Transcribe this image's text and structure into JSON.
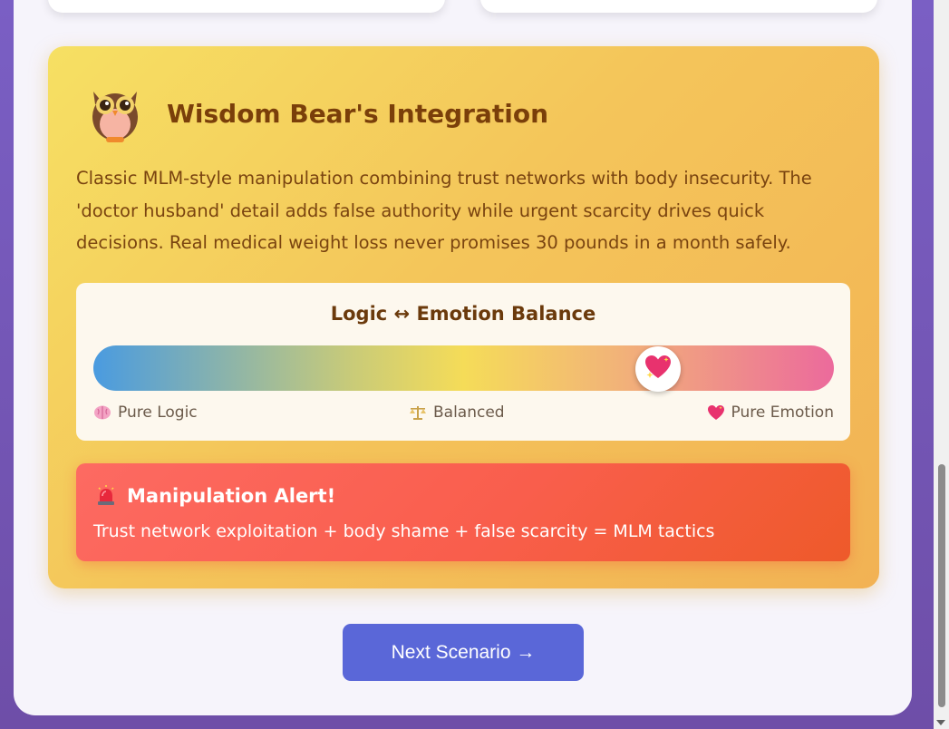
{
  "wisdom": {
    "icon": "owl-icon",
    "title": "Wisdom Bear's Integration",
    "text": "Classic MLM-style manipulation combining trust networks with body insecurity. The 'doctor husband' detail adds false authority while urgent scarcity drives quick decisions. Real medical weight loss never promises 30 pounds in a month safely."
  },
  "balance": {
    "title": "Logic ↔ Emotion Balance",
    "value_fraction": 0.78,
    "thumb_icon": "sparkling-heart-icon",
    "labels": {
      "left": {
        "icon": "brain-icon",
        "text": "Pure Logic"
      },
      "middle": {
        "icon": "scales-icon",
        "text": "Balanced"
      },
      "right": {
        "icon": "heart-icon",
        "text": "Pure Emotion"
      }
    }
  },
  "alert": {
    "icon": "siren-icon",
    "title": "Manipulation Alert!",
    "text": "Trust network exploitation + body shame + false scarcity = MLM tactics"
  },
  "next_button": {
    "label": "Next Scenario →"
  },
  "colors": {
    "accent": "#5a67d8",
    "alert": "#f95e4c",
    "wisdom_title": "#7a3f0a"
  }
}
